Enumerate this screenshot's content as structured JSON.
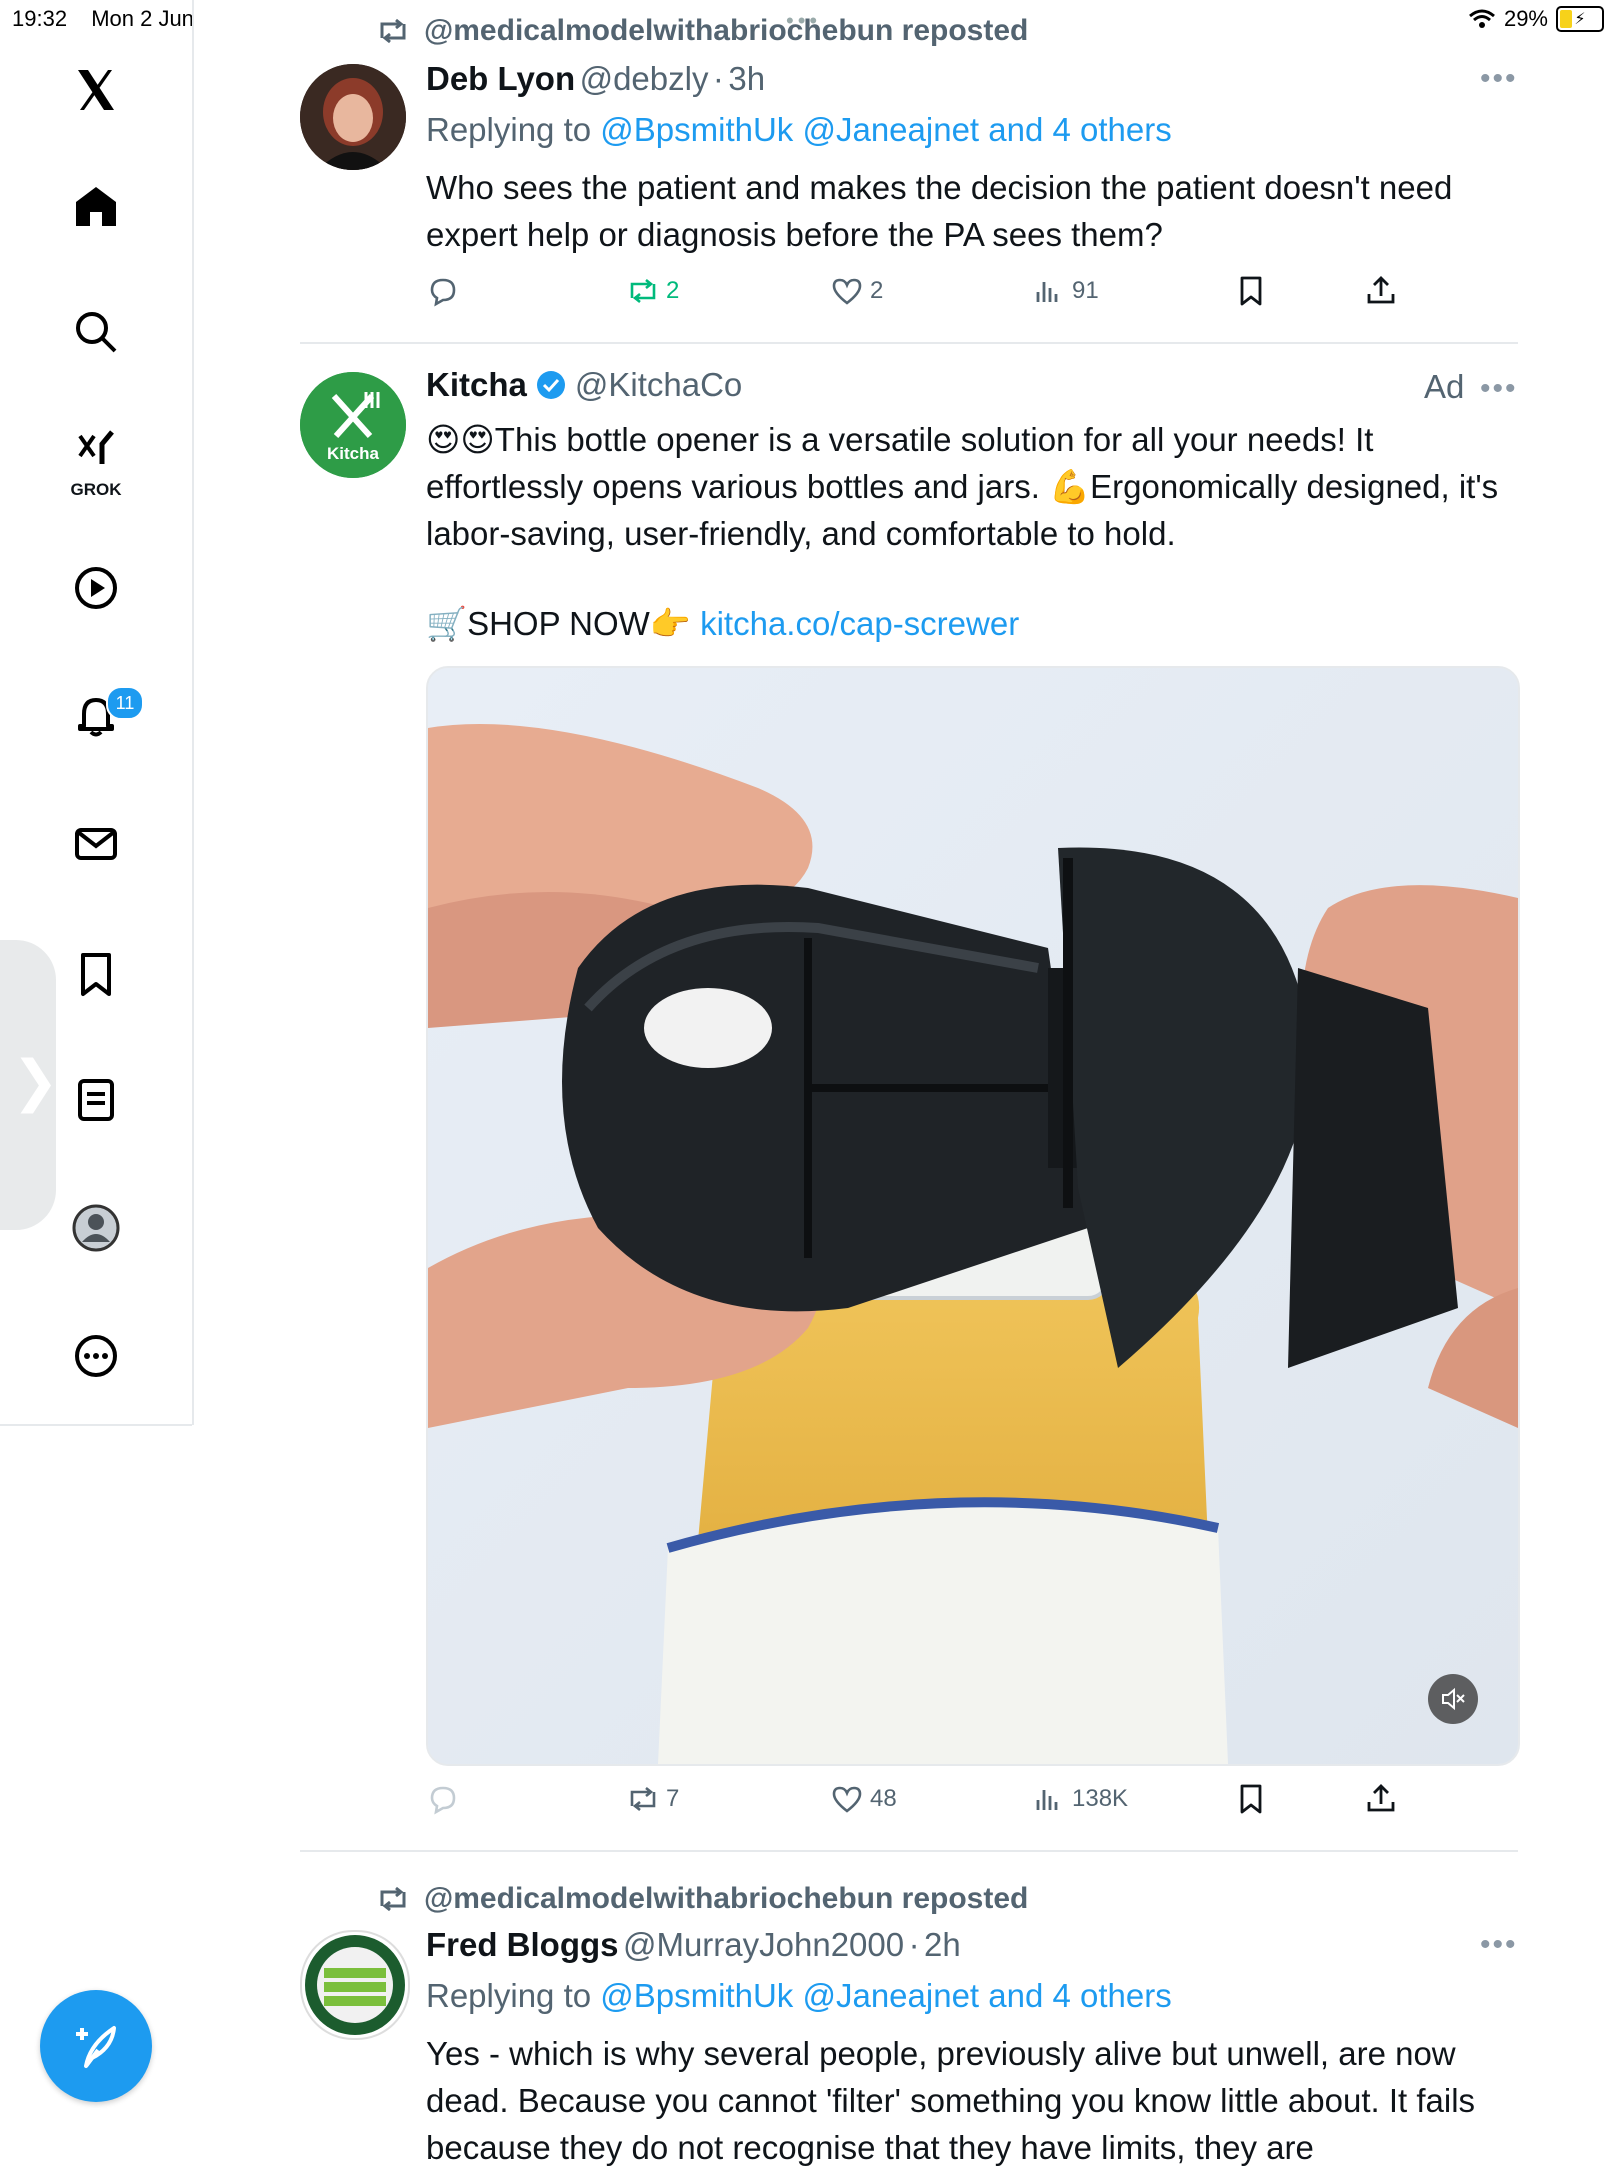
{
  "status_bar": {
    "time": "19:32",
    "date": "Mon 2 Jun",
    "battery": "29%"
  },
  "sidebar": {
    "items": [
      {
        "name": "x-logo-icon"
      },
      {
        "name": "home-icon"
      },
      {
        "name": "search-icon"
      },
      {
        "name": "grok-icon",
        "label": "GROK"
      },
      {
        "name": "video-icon"
      },
      {
        "name": "notifications-icon",
        "badge": "11"
      },
      {
        "name": "messages-icon"
      },
      {
        "name": "bookmarks-icon"
      },
      {
        "name": "lists-icon"
      },
      {
        "name": "profile-icon"
      },
      {
        "name": "more-icon"
      }
    ],
    "compose": "compose-post-icon"
  },
  "posts": [
    {
      "repost_by": "@medicalmodelwithabriochebun reposted",
      "name": "Deb Lyon",
      "handle": "@debzly",
      "sep": "·",
      "time": "3h",
      "reply_prefix": "Replying to ",
      "reply_to": "@BpsmithUk @Janeajnet and 4 others",
      "text": "Who sees the patient and makes the decision the patient doesn't need expert help or diagnosis before the PA sees them?",
      "replies": "",
      "reposts": "2",
      "likes": "2",
      "views": "91"
    },
    {
      "name": "Kitcha",
      "handle": "@KitchaCo",
      "ad": "Ad",
      "avatar_text": "Kitcha",
      "text_line1": "😍😍This bottle opener is a versatile solution for all your needs! It effortlessly opens various bottles and jars. 💪Ergonomically designed, it's labor-saving, user-friendly, and comfortable to hold.",
      "shop_text": "🛒SHOP NOW👉 ",
      "shop_link": "kitcha.co/cap-screwer",
      "reposts": "7",
      "likes": "48",
      "views": "138K"
    },
    {
      "repost_by": "@medicalmodelwithabriochebun reposted",
      "name": "Fred Bloggs",
      "handle": "@MurrayJohn2000",
      "sep": "·",
      "time": "2h",
      "reply_prefix": "Replying to ",
      "reply_to": "@BpsmithUk @Janeajnet and 4 others",
      "text": "Yes - which is why several people, previously alive but unwell, are now dead. Because you cannot 'filter' something you know little about. It fails because they do not recognise that they have limits, they are"
    }
  ],
  "colors": {
    "accent": "#1d9bf0",
    "repost_active": "#00ba7c",
    "muted": "#536471"
  }
}
